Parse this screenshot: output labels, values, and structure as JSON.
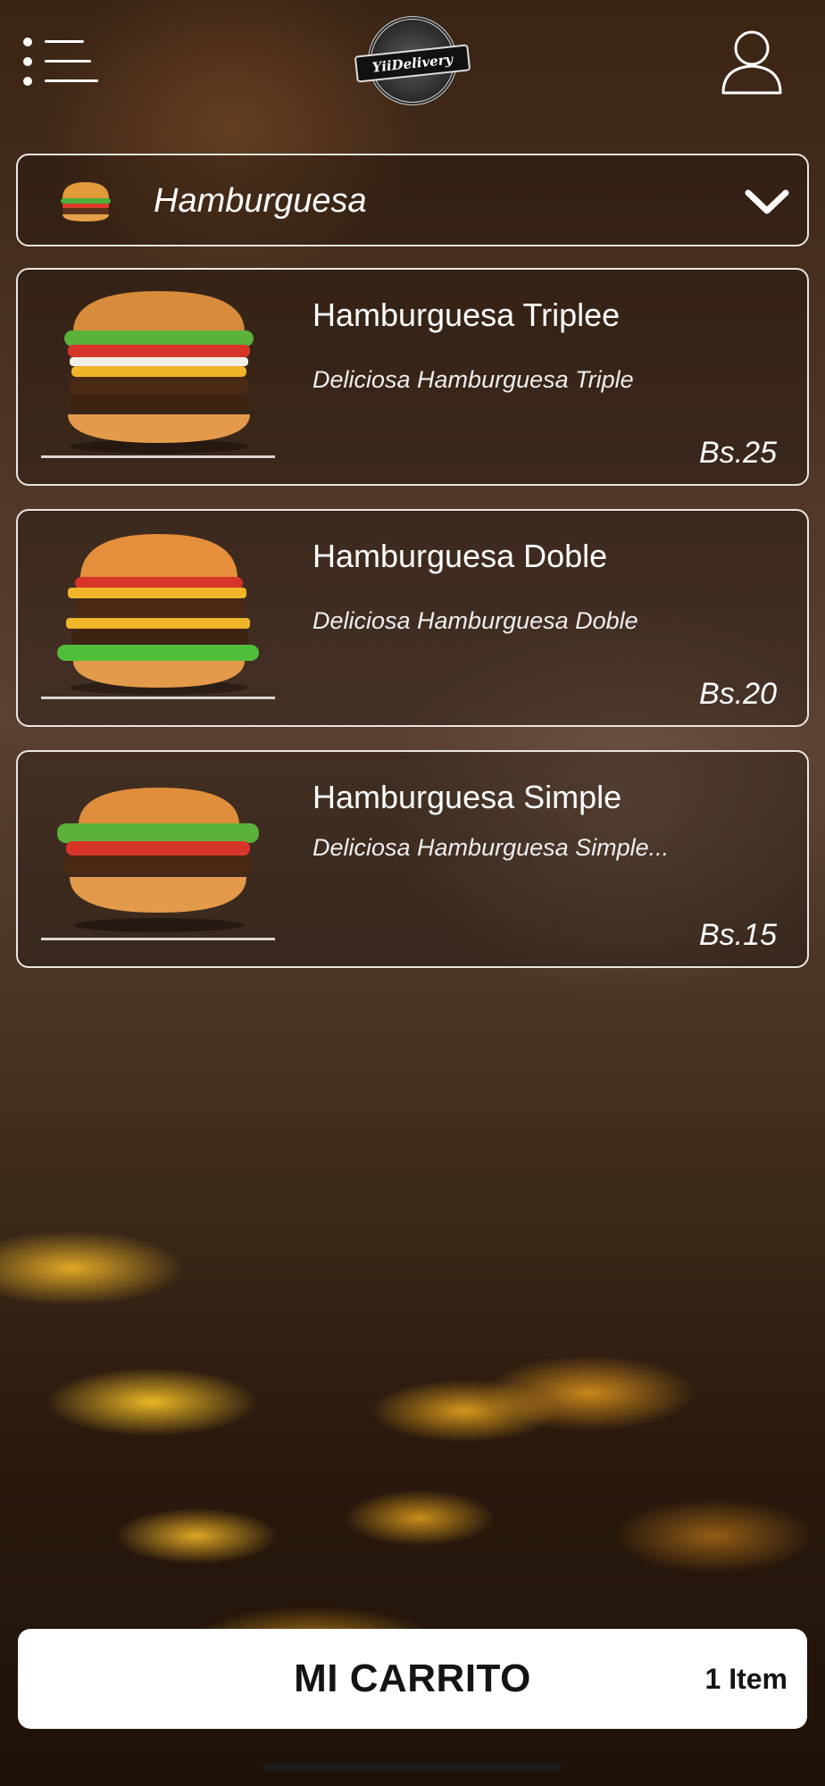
{
  "header": {
    "menu_icon": "hamburger-menu-icon",
    "logo_text": "YiiDelivery",
    "profile_icon": "user-profile-icon"
  },
  "category": {
    "selected": "Hamburguesa",
    "icon": "burger-icon",
    "chevron_icon": "chevron-down-icon"
  },
  "products": [
    {
      "name": "Hamburguesa Triplee",
      "description": "Deliciosa Hamburguesa Triple",
      "price": "Bs.25"
    },
    {
      "name": "Hamburguesa Doble",
      "description": "Deliciosa Hamburguesa Doble",
      "price": "Bs.20"
    },
    {
      "name": "Hamburguesa Simple",
      "description": "Deliciosa Hamburguesa Simple...",
      "price": "Bs.15"
    }
  ],
  "cart": {
    "label": "MI CARRITO",
    "count": "1 Item"
  },
  "colors": {
    "card_border": "#e9e6e2",
    "cart_background": "#ffffff",
    "cart_text": "#141414"
  }
}
